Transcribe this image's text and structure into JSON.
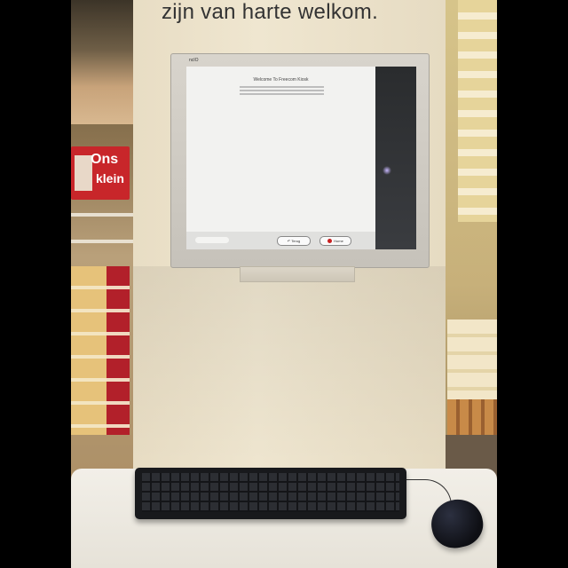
{
  "banner": {
    "text": "zijn van harte welkom."
  },
  "store_sign": {
    "line1": "Ons",
    "line2": "klein"
  },
  "monitor": {
    "brand": "ncIO"
  },
  "app": {
    "title": "Welcome To Freecom Kiosk",
    "back_button": "Terug",
    "home_button": "Home"
  },
  "colors": {
    "sign": "#c8262a",
    "kiosk": "#ece3cc",
    "keyboard": "#18191c"
  }
}
